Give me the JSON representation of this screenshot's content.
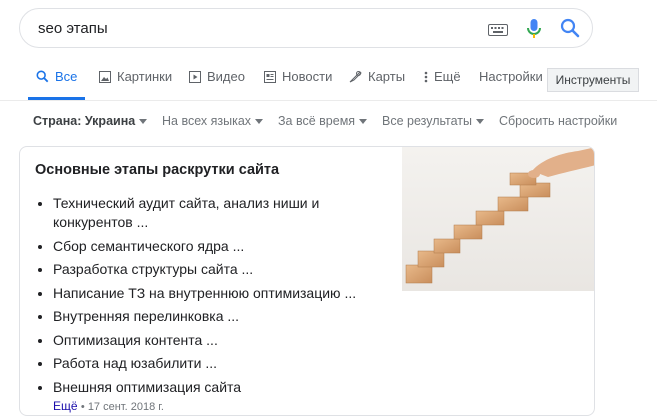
{
  "search": {
    "query": "seo этапы"
  },
  "tabs": [
    {
      "label": "Все",
      "icon": "search-icon",
      "active": true
    },
    {
      "label": "Картинки",
      "icon": "image-icon"
    },
    {
      "label": "Видео",
      "icon": "video-icon"
    },
    {
      "label": "Новости",
      "icon": "news-icon"
    },
    {
      "label": "Карты",
      "icon": "map-icon"
    },
    {
      "label": "Ещё",
      "icon": "more-vert-icon"
    },
    {
      "label": "Настройки"
    }
  ],
  "tools_label": "Инструменты",
  "filters": [
    {
      "label": "Страна: Украина"
    },
    {
      "label": "На всех языках"
    },
    {
      "label": "За всё время"
    },
    {
      "label": "Все результаты"
    },
    {
      "label": "Сбросить настройки"
    }
  ],
  "card": {
    "title": "Основные этапы раскрутки сайта",
    "items": [
      "Технический аудит сайта, анализ ниши и конкурентов ...",
      "Сбор семантического ядра ...",
      "Разработка структуры сайта ...",
      "Написание ТЗ на внутреннюю оптимизацию ...",
      "Внутренняя перелинковка ...",
      "Оптимизация контента ...",
      "Работа над юзабилити ...",
      "Внешняя оптимизация сайта"
    ],
    "more_label": "Ещё",
    "date": "• 17 сент. 2018 г."
  },
  "colors": {
    "accent": "#1a73e8",
    "text": "#202124",
    "muted": "#70757a"
  }
}
